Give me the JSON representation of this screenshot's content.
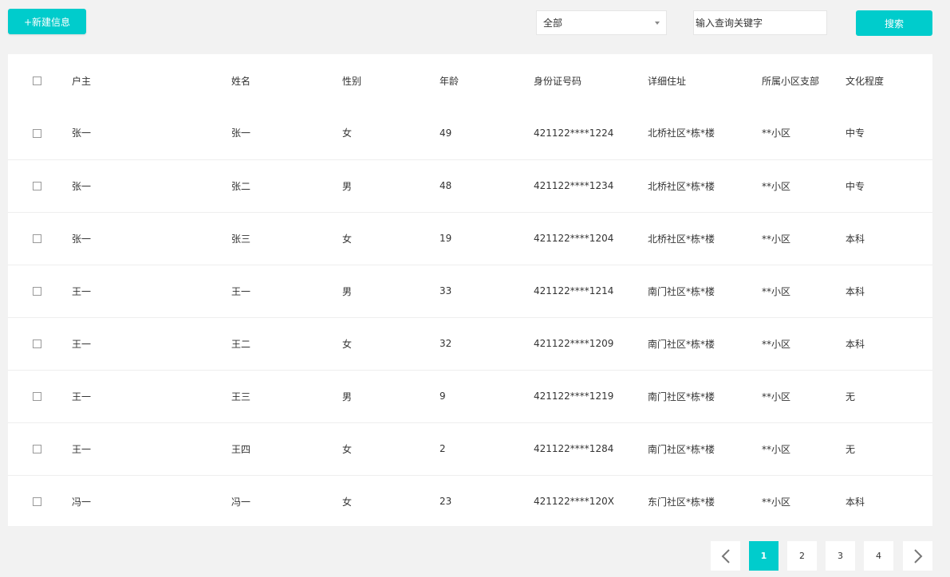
{
  "toolbar": {
    "new_label": "+新建信息",
    "filter_value": "全部",
    "search_placeholder": "输入查询关键字",
    "search_label": "搜索"
  },
  "table": {
    "headers": [
      "户主",
      "姓名",
      "性别",
      "年龄",
      "身份证号码",
      "详细住址",
      "所属小区支部",
      "文化程度"
    ],
    "rows": [
      [
        "张一",
        "张一",
        "女",
        "49",
        "421122****1224",
        "北桥社区*栋*楼",
        "**小区",
        "中专"
      ],
      [
        "张一",
        "张二",
        "男",
        "48",
        "421122****1234",
        "北桥社区*栋*楼",
        "**小区",
        "中专"
      ],
      [
        "张一",
        "张三",
        "女",
        "19",
        "421122****1204",
        "北桥社区*栋*楼",
        "**小区",
        "本科"
      ],
      [
        "王一",
        "王一",
        "男",
        "33",
        "421122****1214",
        "南门社区*栋*楼",
        "**小区",
        "本科"
      ],
      [
        "王一",
        "王二",
        "女",
        "32",
        "421122****1209",
        "南门社区*栋*楼",
        "**小区",
        "本科"
      ],
      [
        "王一",
        "王三",
        "男",
        "9",
        "421122****1219",
        "南门社区*栋*楼",
        "**小区",
        "无"
      ],
      [
        "王一",
        "王四",
        "女",
        "2",
        "421122****1284",
        "南门社区*栋*楼",
        "**小区",
        "无"
      ],
      [
        "冯一",
        "冯一",
        "女",
        "23",
        "421122****120X",
        "东门社区*栋*楼",
        "**小区",
        "本科"
      ]
    ]
  },
  "pagination": {
    "pages": [
      "1",
      "2",
      "3",
      "4"
    ],
    "current": "1",
    "prev_icon": "chevron-left-icon",
    "next_icon": "chevron-right-icon"
  },
  "colors": {
    "accent": "#00cccc",
    "background": "#f2f2f2",
    "panel": "#ffffff"
  }
}
